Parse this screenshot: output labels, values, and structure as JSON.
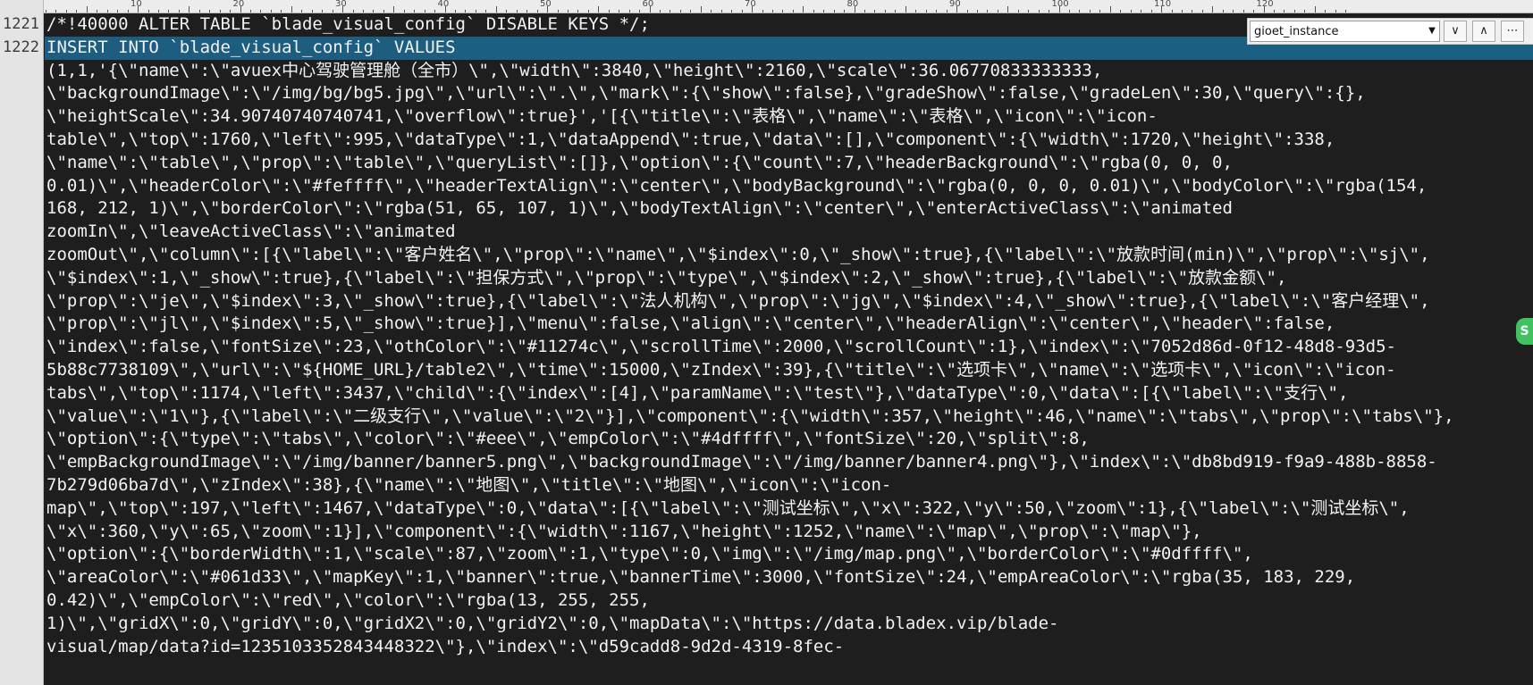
{
  "ruler": {
    "labels": [
      "10",
      "20",
      "30",
      "40",
      "50",
      "60",
      "70",
      "80",
      "90",
      "100",
      "110",
      "120"
    ]
  },
  "find": {
    "query": "gioet_instance",
    "dropdown_icon": "chevron-down-icon",
    "next_label": "∨",
    "prev_label": "∧",
    "close_label": "⋯"
  },
  "lines": [
    {
      "num": "1221",
      "text": "/*!40000 ALTER TABLE `blade_visual_config` DISABLE KEYS */;"
    },
    {
      "num": "1222",
      "text": "INSERT INTO `blade_visual_config` VALUES",
      "highlight": true
    },
    {
      "num": "",
      "text": "(1,1,'{\\\"name\\\":\\\"avuex中心驾驶管理舱（全市）\\\",\\\"width\\\":3840,\\\"height\\\":2160,\\\"scale\\\":36.06770833333333,"
    },
    {
      "num": "",
      "text": "\\\"backgroundImage\\\":\\\"/img/bg/bg5.jpg\\\",\\\"url\\\":\\\".\\\",\\\"mark\\\":{\\\"show\\\":false},\\\"gradeShow\\\":false,\\\"gradeLen\\\":30,\\\"query\\\":{},"
    },
    {
      "num": "",
      "text": "\\\"heightScale\\\":34.90740740740741,\\\"overflow\\\":true}','[{\\\"title\\\":\\\"表格\\\",\\\"name\\\":\\\"表格\\\",\\\"icon\\\":\\\"icon-"
    },
    {
      "num": "",
      "text": "table\\\",\\\"top\\\":1760,\\\"left\\\":995,\\\"dataType\\\":1,\\\"dataAppend\\\":true,\\\"data\\\":[],\\\"component\\\":{\\\"width\\\":1720,\\\"height\\\":338,"
    },
    {
      "num": "",
      "text": "\\\"name\\\":\\\"table\\\",\\\"prop\\\":\\\"table\\\",\\\"queryList\\\":[]},\\\"option\\\":{\\\"count\\\":7,\\\"headerBackground\\\":\\\"rgba(0, 0, 0,"
    },
    {
      "num": "",
      "text": "0.01)\\\",\\\"headerColor\\\":\\\"#feffff\\\",\\\"headerTextAlign\\\":\\\"center\\\",\\\"bodyBackground\\\":\\\"rgba(0, 0, 0, 0.01)\\\",\\\"bodyColor\\\":\\\"rgba(154,"
    },
    {
      "num": "",
      "text": "168, 212, 1)\\\",\\\"borderColor\\\":\\\"rgba(51, 65, 107, 1)\\\",\\\"bodyTextAlign\\\":\\\"center\\\",\\\"enterActiveClass\\\":\\\"animated"
    },
    {
      "num": "",
      "text": "zoomIn\\\",\\\"leaveActiveClass\\\":\\\"animated"
    },
    {
      "num": "",
      "text": "zoomOut\\\",\\\"column\\\":[{\\\"label\\\":\\\"客户姓名\\\",\\\"prop\\\":\\\"name\\\",\\\"$index\\\":0,\\\"_show\\\":true},{\\\"label\\\":\\\"放款时间(min)\\\",\\\"prop\\\":\\\"sj\\\","
    },
    {
      "num": "",
      "text": "\\\"$index\\\":1,\\\"_show\\\":true},{\\\"label\\\":\\\"担保方式\\\",\\\"prop\\\":\\\"type\\\",\\\"$index\\\":2,\\\"_show\\\":true},{\\\"label\\\":\\\"放款金额\\\","
    },
    {
      "num": "",
      "text": "\\\"prop\\\":\\\"je\\\",\\\"$index\\\":3,\\\"_show\\\":true},{\\\"label\\\":\\\"法人机构\\\",\\\"prop\\\":\\\"jg\\\",\\\"$index\\\":4,\\\"_show\\\":true},{\\\"label\\\":\\\"客户经理\\\","
    },
    {
      "num": "",
      "text": "\\\"prop\\\":\\\"jl\\\",\\\"$index\\\":5,\\\"_show\\\":true}],\\\"menu\\\":false,\\\"align\\\":\\\"center\\\",\\\"headerAlign\\\":\\\"center\\\",\\\"header\\\":false,"
    },
    {
      "num": "",
      "text": "\\\"index\\\":false,\\\"fontSize\\\":23,\\\"othColor\\\":\\\"#11274c\\\",\\\"scrollTime\\\":2000,\\\"scrollCount\\\":1},\\\"index\\\":\\\"7052d86d-0f12-48d8-93d5-"
    },
    {
      "num": "",
      "text": "5b88c7738109\\\",\\\"url\\\":\\\"${HOME_URL}/table2\\\",\\\"time\\\":15000,\\\"zIndex\\\":39},{\\\"title\\\":\\\"选项卡\\\",\\\"name\\\":\\\"选项卡\\\",\\\"icon\\\":\\\"icon-"
    },
    {
      "num": "",
      "text": "tabs\\\",\\\"top\\\":1174,\\\"left\\\":3437,\\\"child\\\":{\\\"index\\\":[4],\\\"paramName\\\":\\\"test\\\"},\\\"dataType\\\":0,\\\"data\\\":[{\\\"label\\\":\\\"支行\\\","
    },
    {
      "num": "",
      "text": "\\\"value\\\":\\\"1\\\"},{\\\"label\\\":\\\"二级支行\\\",\\\"value\\\":\\\"2\\\"}],\\\"component\\\":{\\\"width\\\":357,\\\"height\\\":46,\\\"name\\\":\\\"tabs\\\",\\\"prop\\\":\\\"tabs\\\"},"
    },
    {
      "num": "",
      "text": "\\\"option\\\":{\\\"type\\\":\\\"tabs\\\",\\\"color\\\":\\\"#eee\\\",\\\"empColor\\\":\\\"#4dffff\\\",\\\"fontSize\\\":20,\\\"split\\\":8,"
    },
    {
      "num": "",
      "text": "\\\"empBackgroundImage\\\":\\\"/img/banner/banner5.png\\\",\\\"backgroundImage\\\":\\\"/img/banner/banner4.png\\\"},\\\"index\\\":\\\"db8bd919-f9a9-488b-8858-"
    },
    {
      "num": "",
      "text": "7b279d06ba7d\\\",\\\"zIndex\\\":38},{\\\"name\\\":\\\"地图\\\",\\\"title\\\":\\\"地图\\\",\\\"icon\\\":\\\"icon-"
    },
    {
      "num": "",
      "text": "map\\\",\\\"top\\\":197,\\\"left\\\":1467,\\\"dataType\\\":0,\\\"data\\\":[{\\\"label\\\":\\\"测试坐标\\\",\\\"x\\\":322,\\\"y\\\":50,\\\"zoom\\\":1},{\\\"label\\\":\\\"测试坐标\\\","
    },
    {
      "num": "",
      "text": "\\\"x\\\":360,\\\"y\\\":65,\\\"zoom\\\":1}],\\\"component\\\":{\\\"width\\\":1167,\\\"height\\\":1252,\\\"name\\\":\\\"map\\\",\\\"prop\\\":\\\"map\\\"},"
    },
    {
      "num": "",
      "text": "\\\"option\\\":{\\\"borderWidth\\\":1,\\\"scale\\\":87,\\\"zoom\\\":1,\\\"type\\\":0,\\\"img\\\":\\\"/img/map.png\\\",\\\"borderColor\\\":\\\"#0dffff\\\","
    },
    {
      "num": "",
      "text": "\\\"areaColor\\\":\\\"#061d33\\\",\\\"mapKey\\\":1,\\\"banner\\\":true,\\\"bannerTime\\\":3000,\\\"fontSize\\\":24,\\\"empAreaColor\\\":\\\"rgba(35, 183, 229,"
    },
    {
      "num": "",
      "text": "0.42)\\\",\\\"empColor\\\":\\\"red\\\",\\\"color\\\":\\\"rgba(13, 255, 255,"
    },
    {
      "num": "",
      "text": "1)\\\",\\\"gridX\\\":0,\\\"gridY\\\":0,\\\"gridX2\\\":0,\\\"gridY2\\\":0,\\\"mapData\\\":\\\"https://data.bladex.vip/blade-"
    },
    {
      "num": "",
      "text": "visual/map/data?id=1235103352843448322\\\"},\\\"index\\\":\\\"d59cadd8-9d2d-4319-8fec-"
    }
  ],
  "colors": {
    "background": "#1e1e1e",
    "text": "#f2f2f2",
    "highlight": "#1b5f82",
    "gutter": "#e4e4e4",
    "side_badge": "#3fc25f"
  },
  "side_badge": {
    "icon": "app-badge-icon",
    "glyph": "S"
  }
}
